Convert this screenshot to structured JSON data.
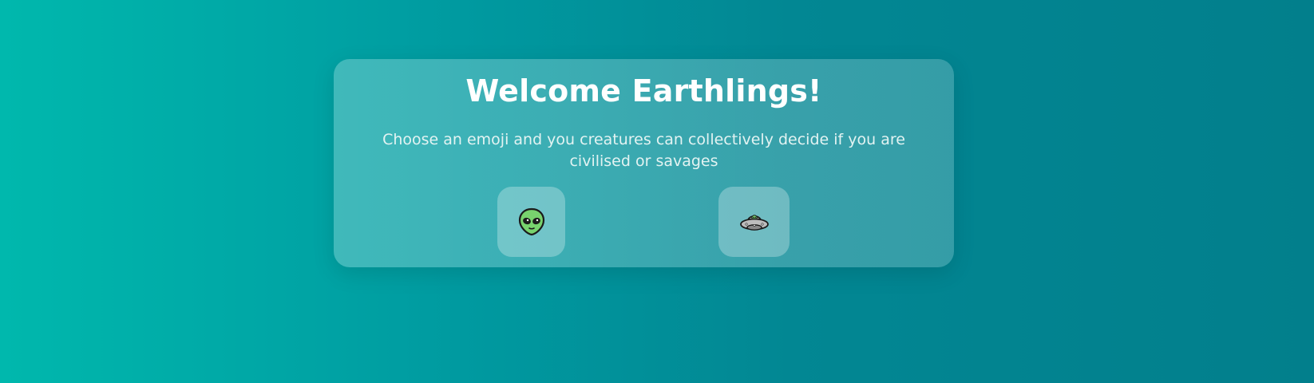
{
  "card": {
    "title": "Welcome Earthlings!",
    "subtitle": "Choose an emoji and you creatures can collectively decide if you are civilised or savages"
  },
  "emojis": [
    {
      "icon": "alien-icon",
      "glyph": "👽"
    },
    {
      "icon": "flying-saucer-icon",
      "glyph": "🛸"
    }
  ]
}
